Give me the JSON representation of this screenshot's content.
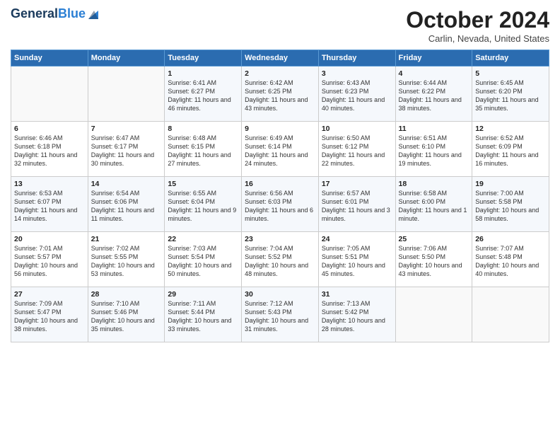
{
  "header": {
    "logo_line1": "General",
    "logo_line2": "Blue",
    "month_title": "October 2024",
    "location": "Carlin, Nevada, United States"
  },
  "days_of_week": [
    "Sunday",
    "Monday",
    "Tuesday",
    "Wednesday",
    "Thursday",
    "Friday",
    "Saturday"
  ],
  "weeks": [
    [
      {
        "day": "",
        "sunrise": "",
        "sunset": "",
        "daylight": ""
      },
      {
        "day": "",
        "sunrise": "",
        "sunset": "",
        "daylight": ""
      },
      {
        "day": "1",
        "sunrise": "Sunrise: 6:41 AM",
        "sunset": "Sunset: 6:27 PM",
        "daylight": "Daylight: 11 hours and 46 minutes."
      },
      {
        "day": "2",
        "sunrise": "Sunrise: 6:42 AM",
        "sunset": "Sunset: 6:25 PM",
        "daylight": "Daylight: 11 hours and 43 minutes."
      },
      {
        "day": "3",
        "sunrise": "Sunrise: 6:43 AM",
        "sunset": "Sunset: 6:23 PM",
        "daylight": "Daylight: 11 hours and 40 minutes."
      },
      {
        "day": "4",
        "sunrise": "Sunrise: 6:44 AM",
        "sunset": "Sunset: 6:22 PM",
        "daylight": "Daylight: 11 hours and 38 minutes."
      },
      {
        "day": "5",
        "sunrise": "Sunrise: 6:45 AM",
        "sunset": "Sunset: 6:20 PM",
        "daylight": "Daylight: 11 hours and 35 minutes."
      }
    ],
    [
      {
        "day": "6",
        "sunrise": "Sunrise: 6:46 AM",
        "sunset": "Sunset: 6:18 PM",
        "daylight": "Daylight: 11 hours and 32 minutes."
      },
      {
        "day": "7",
        "sunrise": "Sunrise: 6:47 AM",
        "sunset": "Sunset: 6:17 PM",
        "daylight": "Daylight: 11 hours and 30 minutes."
      },
      {
        "day": "8",
        "sunrise": "Sunrise: 6:48 AM",
        "sunset": "Sunset: 6:15 PM",
        "daylight": "Daylight: 11 hours and 27 minutes."
      },
      {
        "day": "9",
        "sunrise": "Sunrise: 6:49 AM",
        "sunset": "Sunset: 6:14 PM",
        "daylight": "Daylight: 11 hours and 24 minutes."
      },
      {
        "day": "10",
        "sunrise": "Sunrise: 6:50 AM",
        "sunset": "Sunset: 6:12 PM",
        "daylight": "Daylight: 11 hours and 22 minutes."
      },
      {
        "day": "11",
        "sunrise": "Sunrise: 6:51 AM",
        "sunset": "Sunset: 6:10 PM",
        "daylight": "Daylight: 11 hours and 19 minutes."
      },
      {
        "day": "12",
        "sunrise": "Sunrise: 6:52 AM",
        "sunset": "Sunset: 6:09 PM",
        "daylight": "Daylight: 11 hours and 16 minutes."
      }
    ],
    [
      {
        "day": "13",
        "sunrise": "Sunrise: 6:53 AM",
        "sunset": "Sunset: 6:07 PM",
        "daylight": "Daylight: 11 hours and 14 minutes."
      },
      {
        "day": "14",
        "sunrise": "Sunrise: 6:54 AM",
        "sunset": "Sunset: 6:06 PM",
        "daylight": "Daylight: 11 hours and 11 minutes."
      },
      {
        "day": "15",
        "sunrise": "Sunrise: 6:55 AM",
        "sunset": "Sunset: 6:04 PM",
        "daylight": "Daylight: 11 hours and 9 minutes."
      },
      {
        "day": "16",
        "sunrise": "Sunrise: 6:56 AM",
        "sunset": "Sunset: 6:03 PM",
        "daylight": "Daylight: 11 hours and 6 minutes."
      },
      {
        "day": "17",
        "sunrise": "Sunrise: 6:57 AM",
        "sunset": "Sunset: 6:01 PM",
        "daylight": "Daylight: 11 hours and 3 minutes."
      },
      {
        "day": "18",
        "sunrise": "Sunrise: 6:58 AM",
        "sunset": "Sunset: 6:00 PM",
        "daylight": "Daylight: 11 hours and 1 minute."
      },
      {
        "day": "19",
        "sunrise": "Sunrise: 7:00 AM",
        "sunset": "Sunset: 5:58 PM",
        "daylight": "Daylight: 10 hours and 58 minutes."
      }
    ],
    [
      {
        "day": "20",
        "sunrise": "Sunrise: 7:01 AM",
        "sunset": "Sunset: 5:57 PM",
        "daylight": "Daylight: 10 hours and 56 minutes."
      },
      {
        "day": "21",
        "sunrise": "Sunrise: 7:02 AM",
        "sunset": "Sunset: 5:55 PM",
        "daylight": "Daylight: 10 hours and 53 minutes."
      },
      {
        "day": "22",
        "sunrise": "Sunrise: 7:03 AM",
        "sunset": "Sunset: 5:54 PM",
        "daylight": "Daylight: 10 hours and 50 minutes."
      },
      {
        "day": "23",
        "sunrise": "Sunrise: 7:04 AM",
        "sunset": "Sunset: 5:52 PM",
        "daylight": "Daylight: 10 hours and 48 minutes."
      },
      {
        "day": "24",
        "sunrise": "Sunrise: 7:05 AM",
        "sunset": "Sunset: 5:51 PM",
        "daylight": "Daylight: 10 hours and 45 minutes."
      },
      {
        "day": "25",
        "sunrise": "Sunrise: 7:06 AM",
        "sunset": "Sunset: 5:50 PM",
        "daylight": "Daylight: 10 hours and 43 minutes."
      },
      {
        "day": "26",
        "sunrise": "Sunrise: 7:07 AM",
        "sunset": "Sunset: 5:48 PM",
        "daylight": "Daylight: 10 hours and 40 minutes."
      }
    ],
    [
      {
        "day": "27",
        "sunrise": "Sunrise: 7:09 AM",
        "sunset": "Sunset: 5:47 PM",
        "daylight": "Daylight: 10 hours and 38 minutes."
      },
      {
        "day": "28",
        "sunrise": "Sunrise: 7:10 AM",
        "sunset": "Sunset: 5:46 PM",
        "daylight": "Daylight: 10 hours and 35 minutes."
      },
      {
        "day": "29",
        "sunrise": "Sunrise: 7:11 AM",
        "sunset": "Sunset: 5:44 PM",
        "daylight": "Daylight: 10 hours and 33 minutes."
      },
      {
        "day": "30",
        "sunrise": "Sunrise: 7:12 AM",
        "sunset": "Sunset: 5:43 PM",
        "daylight": "Daylight: 10 hours and 31 minutes."
      },
      {
        "day": "31",
        "sunrise": "Sunrise: 7:13 AM",
        "sunset": "Sunset: 5:42 PM",
        "daylight": "Daylight: 10 hours and 28 minutes."
      },
      {
        "day": "",
        "sunrise": "",
        "sunset": "",
        "daylight": ""
      },
      {
        "day": "",
        "sunrise": "",
        "sunset": "",
        "daylight": ""
      }
    ]
  ]
}
